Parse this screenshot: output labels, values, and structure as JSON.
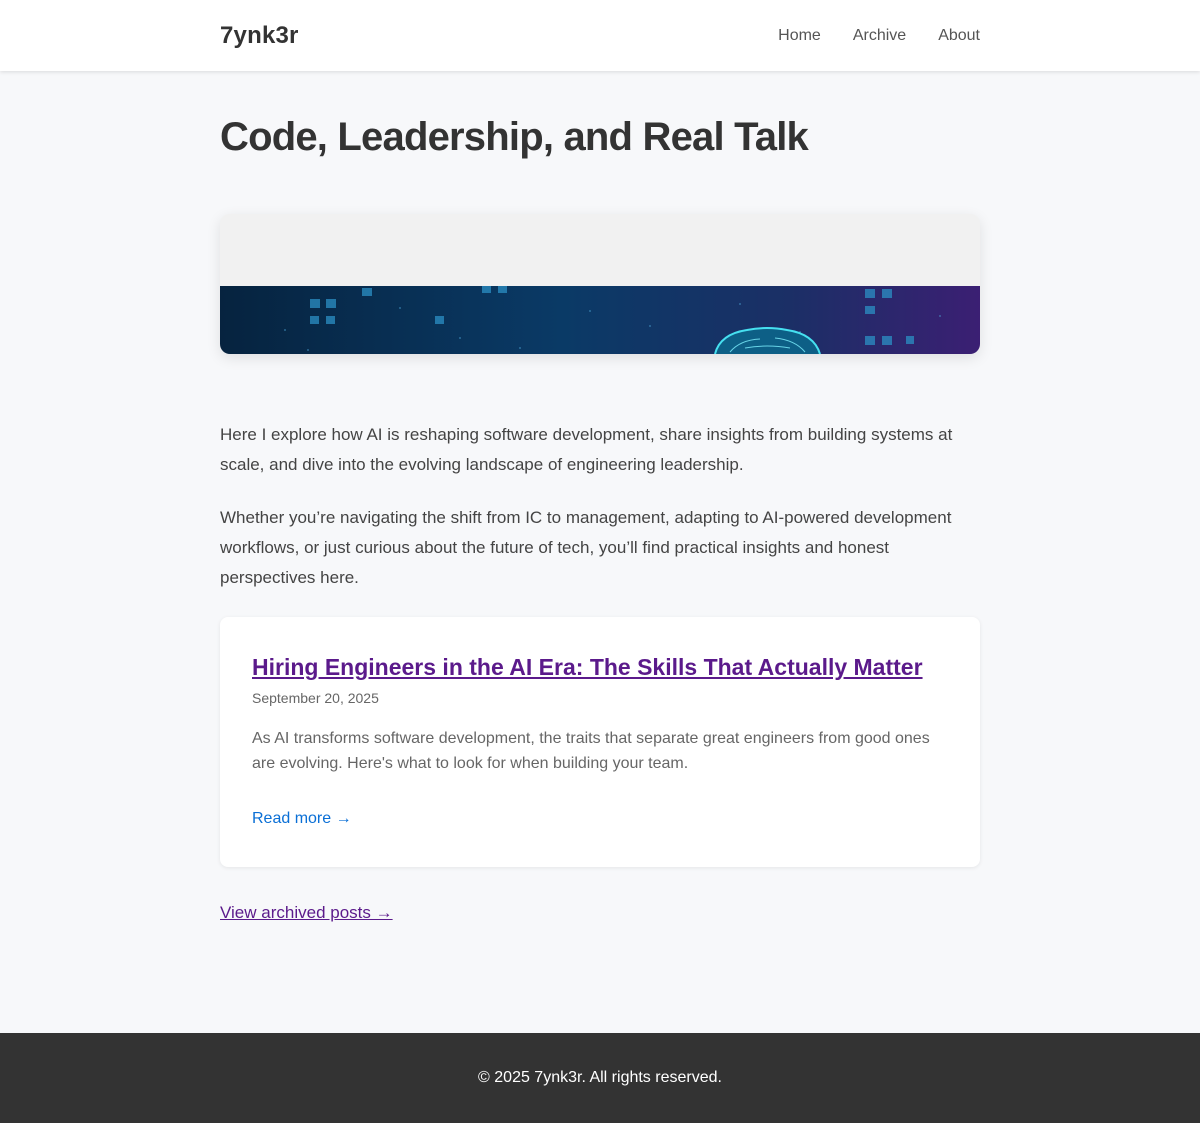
{
  "header": {
    "logo": "7ynk3r",
    "nav": [
      {
        "label": "Home"
      },
      {
        "label": "Archive"
      },
      {
        "label": "About"
      }
    ]
  },
  "main": {
    "title": "Code, Leadership, and Real Talk",
    "hero_image": "ai-brain-circuit-banner",
    "intro": [
      "Here I explore how AI is reshaping software development, share insights from building systems at scale, and dive into the evolving landscape of engineering leadership.",
      "Whether you’re navigating the shift from IC to management, adapting to AI-powered development workflows, or just curious about the future of tech, you’ll find practical insights and honest perspectives here."
    ],
    "posts": [
      {
        "title": "Hiring Engineers in the AI Era: The Skills That Actually Matter",
        "date": "September 20, 2025",
        "excerpt": "As AI transforms software development, the traits that separate great engineers from good ones are evolving. Here's what to look for when building your team.",
        "read_more": "Read more →"
      }
    ],
    "archive_link": "View archived posts →"
  },
  "footer": {
    "text": "© 2025 7ynk3r. All rights reserved."
  },
  "colors": {
    "background": "#f7f8fa",
    "link_visited": "#5b1a8b",
    "accent": "#0a6fd6",
    "footer_bg": "#333333"
  }
}
